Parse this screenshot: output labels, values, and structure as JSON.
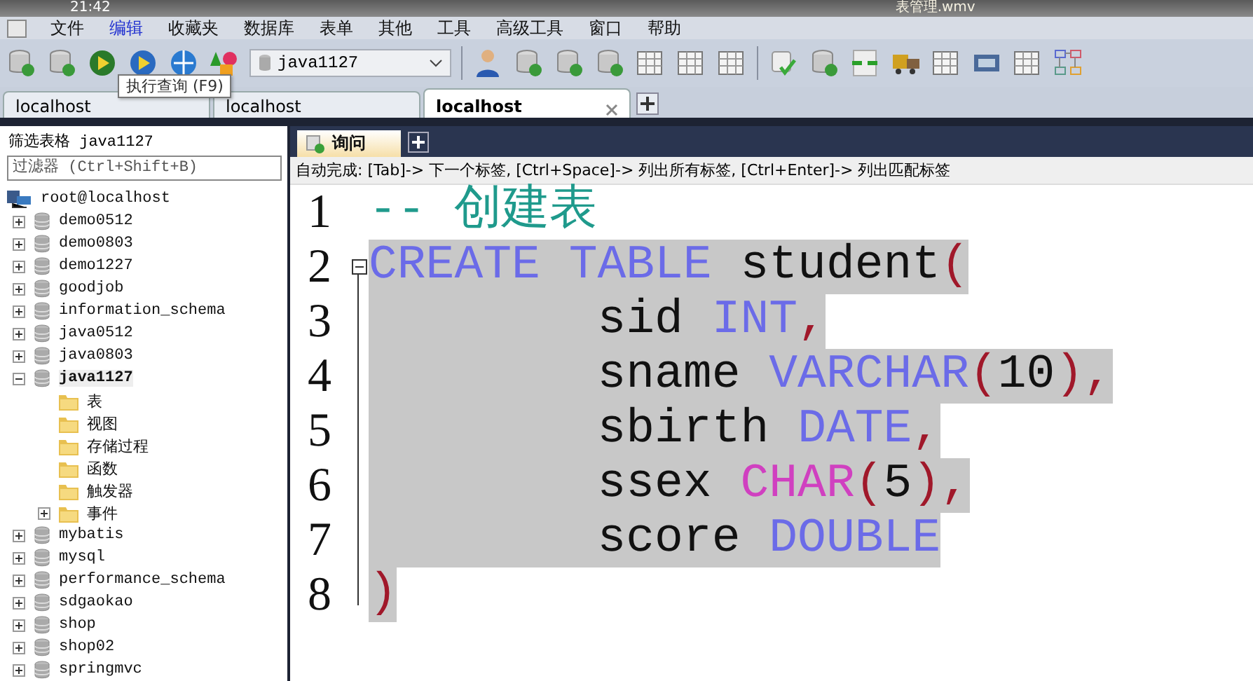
{
  "title_bar": {
    "time": "21:42",
    "file": "表管理.wmv"
  },
  "menu": [
    {
      "label": "文件",
      "selected": false
    },
    {
      "label": "编辑",
      "selected": true
    },
    {
      "label": "收藏夹",
      "selected": false
    },
    {
      "label": "数据库",
      "selected": false
    },
    {
      "label": "表单",
      "selected": false
    },
    {
      "label": "其他",
      "selected": false
    },
    {
      "label": "工具",
      "selected": false
    },
    {
      "label": "高级工具",
      "selected": false
    },
    {
      "label": "窗口",
      "selected": false
    },
    {
      "label": "帮助",
      "selected": false
    }
  ],
  "toolbar": {
    "database_select": "java1127",
    "tooltip": "执行查询 (F9)"
  },
  "connection_tabs": [
    {
      "label": "localhost",
      "selected": false
    },
    {
      "label": "localhost",
      "selected": false
    },
    {
      "label": "localhost",
      "selected": true
    }
  ],
  "sidebar": {
    "title": "筛选表格 java1127",
    "filter": {
      "placeholder": "过滤器 (Ctrl+Shift+B)"
    },
    "root": "root@localhost",
    "items": [
      {
        "label": "demo0512",
        "kind": "database",
        "expanded": false,
        "selected": false
      },
      {
        "label": "demo0803",
        "kind": "database",
        "expanded": false,
        "selected": false
      },
      {
        "label": "demo1227",
        "kind": "database",
        "expanded": false,
        "selected": false
      },
      {
        "label": "goodjob",
        "kind": "database",
        "expanded": false,
        "selected": false
      },
      {
        "label": "information_schema",
        "kind": "database",
        "expanded": false,
        "selected": false
      },
      {
        "label": "java0512",
        "kind": "database",
        "expanded": false,
        "selected": false
      },
      {
        "label": "java0803",
        "kind": "database",
        "expanded": false,
        "selected": false
      },
      {
        "label": "java1127",
        "kind": "database",
        "expanded": true,
        "selected": true,
        "children": [
          {
            "label": "表",
            "kind": "folder",
            "expandable": false
          },
          {
            "label": "视图",
            "kind": "folder",
            "expandable": false
          },
          {
            "label": "存储过程",
            "kind": "folder",
            "expandable": false
          },
          {
            "label": "函数",
            "kind": "folder",
            "expandable": false
          },
          {
            "label": "触发器",
            "kind": "folder",
            "expandable": false
          },
          {
            "label": "事件",
            "kind": "folder",
            "expandable": true
          }
        ]
      },
      {
        "label": "mybatis",
        "kind": "database",
        "expanded": false,
        "selected": false
      },
      {
        "label": "mysql",
        "kind": "database",
        "expanded": false,
        "selected": false
      },
      {
        "label": "performance_schema",
        "kind": "database",
        "expanded": false,
        "selected": false
      },
      {
        "label": "sdgaokao",
        "kind": "database",
        "expanded": false,
        "selected": false
      },
      {
        "label": "shop",
        "kind": "database",
        "expanded": false,
        "selected": false
      },
      {
        "label": "shop02",
        "kind": "database",
        "expanded": false,
        "selected": false
      },
      {
        "label": "springmvc",
        "kind": "database",
        "expanded": false,
        "selected": false
      }
    ]
  },
  "query_tabs": [
    {
      "label": "询问",
      "selected": true
    }
  ],
  "hint": "自动完成: [Tab]-> 下一个标签, [Ctrl+Space]-> 列出所有标签, [Ctrl+Enter]-> 列出匹配标签",
  "editor": {
    "lines": [
      {
        "number": "1",
        "selected": false,
        "fold": false,
        "tokens": [
          {
            "kind": "comment",
            "text": "-- 创建表"
          }
        ]
      },
      {
        "number": "2",
        "selected": true,
        "fold": true,
        "tokens": [
          {
            "kind": "keyword",
            "text": "CREATE TABLE"
          },
          {
            "kind": "plain",
            "text": " student"
          },
          {
            "kind": "paren",
            "text": "("
          }
        ]
      },
      {
        "number": "3",
        "selected": true,
        "fold": false,
        "tokens": [
          {
            "kind": "plain",
            "text": "        sid "
          },
          {
            "kind": "keyword",
            "text": "INT"
          },
          {
            "kind": "paren",
            "text": ","
          }
        ]
      },
      {
        "number": "4",
        "selected": true,
        "fold": false,
        "tokens": [
          {
            "kind": "plain",
            "text": "        sname "
          },
          {
            "kind": "keyword",
            "text": "VARCHAR"
          },
          {
            "kind": "paren",
            "text": "("
          },
          {
            "kind": "plain",
            "text": "10"
          },
          {
            "kind": "paren",
            "text": "),"
          }
        ]
      },
      {
        "number": "5",
        "selected": true,
        "fold": false,
        "tokens": [
          {
            "kind": "plain",
            "text": "        sbirth "
          },
          {
            "kind": "keyword",
            "text": "DATE"
          },
          {
            "kind": "paren",
            "text": ","
          }
        ]
      },
      {
        "number": "6",
        "selected": true,
        "fold": false,
        "tokens": [
          {
            "kind": "plain",
            "text": "        ssex "
          },
          {
            "kind": "function",
            "text": "CHAR"
          },
          {
            "kind": "paren",
            "text": "("
          },
          {
            "kind": "plain",
            "text": "5"
          },
          {
            "kind": "paren",
            "text": "),"
          }
        ]
      },
      {
        "number": "7",
        "selected": true,
        "fold": false,
        "tokens": [
          {
            "kind": "plain",
            "text": "        score "
          },
          {
            "kind": "keyword",
            "text": "DOUBLE"
          }
        ]
      },
      {
        "number": "8",
        "selected": true,
        "fold": false,
        "tokens": [
          {
            "kind": "paren",
            "text": ")"
          }
        ]
      }
    ]
  }
}
